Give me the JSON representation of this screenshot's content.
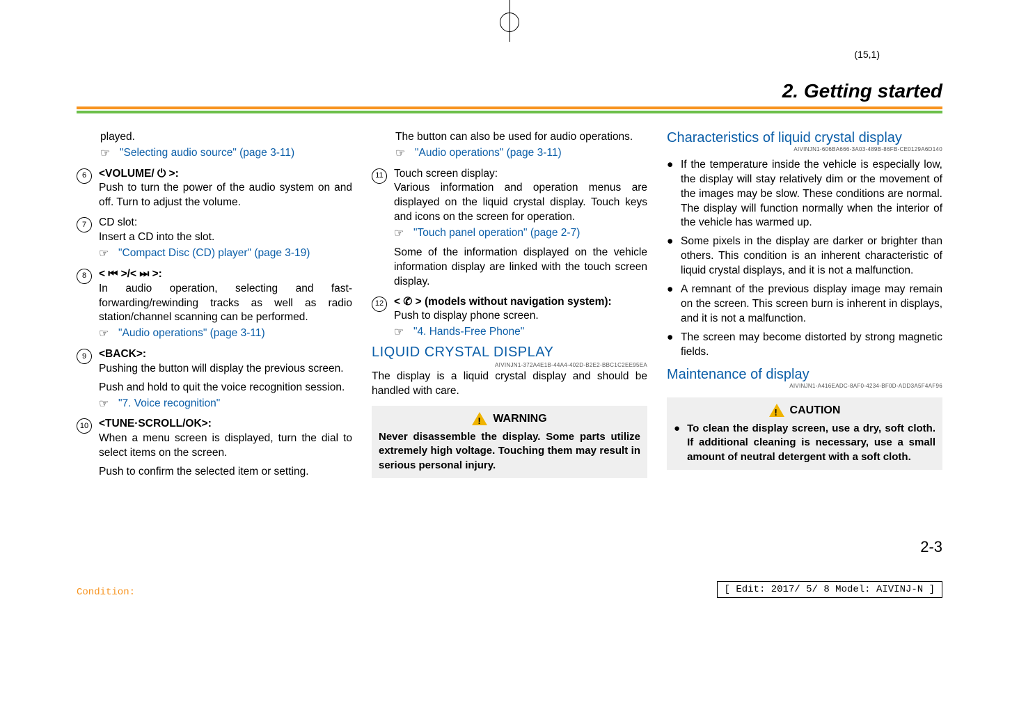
{
  "coord": "(15,1)",
  "chapter": "2. Getting started",
  "col1": {
    "played": "played.",
    "ref_sel_audio": "\"Selecting audio source\" (page 3-11)",
    "i6_label": "<VOLUME/ ⏻ >:",
    "i6_body": "Push to turn the power of the audio system on and off. Turn to adjust the volume.",
    "i7_label": "CD slot:",
    "i7_body": "Insert a CD into the slot.",
    "ref_cd": "\"Compact Disc (CD) player\" (page 3-19)",
    "i8_label": "< ⏮ >/< ⏭ >:",
    "i8_body": "In audio operation, selecting and fast-forwarding/rewinding tracks as well as radio station/channel scanning can be performed.",
    "ref_audio_ops_1": "\"Audio operations\" (page 3-11)",
    "i9_label": "<BACK>:",
    "i9_body1": "Pushing the button will display the previous screen.",
    "i9_body2": "Push and hold to quit the voice recognition session.",
    "ref_voice": "\"7. Voice recognition\"",
    "i10_label": "<TUNE·SCROLL/OK>:",
    "i10_body1": "When a menu screen is displayed, turn the dial to select items on the screen.",
    "i10_body2": "Push to confirm the selected item or setting."
  },
  "col2": {
    "cont": "The button can also be used for audio operations.",
    "ref_audio_ops_2": "\"Audio operations\" (page 3-11)",
    "i11_label": "Touch screen display:",
    "i11_body": "Various information and operation menus are displayed on the liquid crystal display. Touch keys and icons on the screen for operation.",
    "ref_touch": "\"Touch panel operation\" (page 2-7)",
    "i11_body2": "Some of the information displayed on the vehicle information display are linked with the touch screen display.",
    "i12_label": "< ✆ > (models without navigation system):",
    "i12_body": "Push to display phone screen.",
    "ref_hf": "\"4. Hands-Free Phone\"",
    "lcd_head": "LIQUID CRYSTAL DISPLAY",
    "lcd_id": "AIVINJN1-372A4E1B-44A4-402D-B2E2-BBC1C2EE95EA",
    "lcd_body": "The display is a liquid crystal display and should be handled with care.",
    "warn_title": "WARNING",
    "warn_body": "Never disassemble the display. Some parts utilize extremely high voltage. Touching them may result in serious personal injury."
  },
  "col3": {
    "char_head": "Characteristics of liquid crystal display",
    "char_id": "AIVINJN1-606BA666-3A03-489B-86FB-CE0129A6D140",
    "b1": "If the temperature inside the vehicle is especially low, the display will stay relatively dim or the movement of the images may be slow. These conditions are normal. The display will function normally when the interior of the vehicle has warmed up.",
    "b2": "Some pixels in the display are darker or brighter than others. This condition is an inherent characteristic of liquid crystal displays, and it is not a malfunction.",
    "b3": "A remnant of the previous display image may remain on the screen. This screen burn is inherent in displays, and it is not a malfunction.",
    "b4": "The screen may become distorted by strong magnetic fields.",
    "maint_head": "Maintenance of display",
    "maint_id": "AIVINJN1-A416EADC-8AF0-4234-BF0D-ADD3A5F4AF96",
    "caution_title": "CAUTION",
    "caution_body": "To clean the display screen, use a dry, soft cloth. If additional cleaning is necessary, use a small amount of neutral detergent with a soft cloth."
  },
  "page_number": "2-3",
  "edit_line": "[ Edit: 2017/ 5/ 8    Model: AIVINJ-N ]",
  "condition_label": "Condition:"
}
